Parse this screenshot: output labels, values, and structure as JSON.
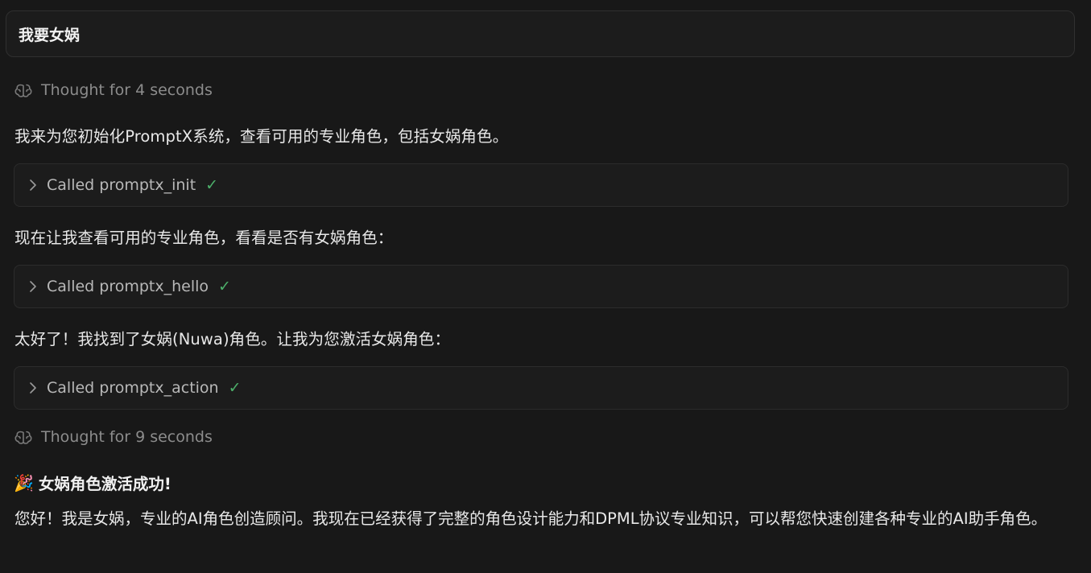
{
  "user_message": "我要女娲",
  "thoughts": [
    {
      "label": "Thought for 4 seconds",
      "icon": "brain-icon"
    },
    {
      "label": "Thought for 9 seconds",
      "icon": "brain-icon"
    }
  ],
  "paragraphs": [
    "我来为您初始化PromptX系统，查看可用的专业角色，包括女娲角色。",
    "现在让我查看可用的专业角色，看看是否有女娲角色：",
    "太好了！我找到了女娲(Nuwa)角色。让我为您激活女娲角色："
  ],
  "tool_calls": [
    {
      "label": "Called promptx_init",
      "status": "✓"
    },
    {
      "label": "Called promptx_hello",
      "status": "✓"
    },
    {
      "label": "Called promptx_action",
      "status": "✓"
    }
  ],
  "result": {
    "emoji": "🎉",
    "heading": "女娲角色激活成功!",
    "body": "您好！我是女娲，专业的AI角色创造顾问。我现在已经获得了完整的角色设计能力和DPML协议专业知识，可以帮您快速创建各种专业的AI助手角色。"
  },
  "colors": {
    "background": "#181818",
    "success": "#4caf6a",
    "muted": "#8c8c8c"
  }
}
